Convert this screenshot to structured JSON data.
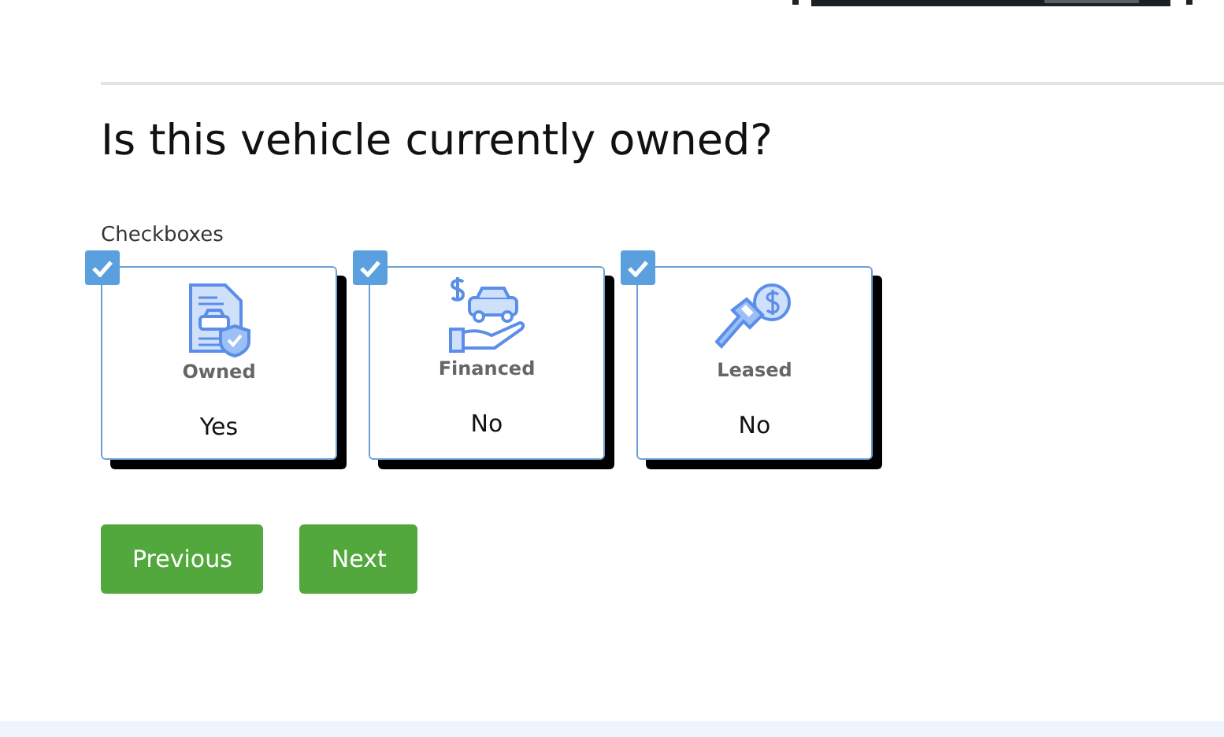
{
  "header_image": {
    "kind": "picture"
  },
  "question": "Is this vehicle currently owned?",
  "group_label": "Checkboxes",
  "options": [
    {
      "kind": "owned",
      "caption": "Owned",
      "value": "Yes",
      "checked": true
    },
    {
      "kind": "financed",
      "caption": "Financed",
      "value": "No",
      "checked": true
    },
    {
      "kind": "leased",
      "caption": "Leased",
      "value": "No",
      "checked": true
    }
  ],
  "buttons": [
    "Previous",
    "Next"
  ]
}
